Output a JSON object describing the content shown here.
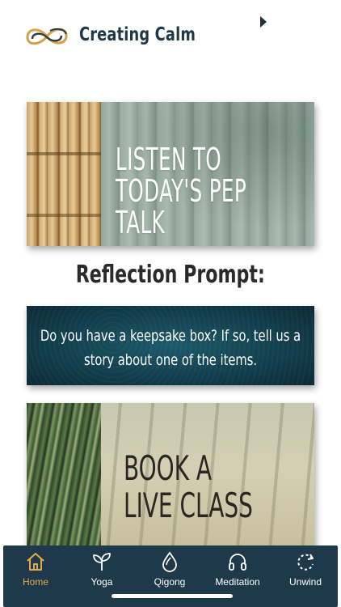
{
  "app": {
    "title": "Creating Calm",
    "logo_icon": "infinity-logo-icon"
  },
  "header": {
    "play_icon": "play-triangle-icon"
  },
  "pep_card": {
    "text_line1": "LISTEN TO",
    "text_line2": "TODAY'S PEP TALK"
  },
  "reflection": {
    "heading": "Reflection Prompt:",
    "prompt_line1": "Do you have a keepsake box? If so, tell us a",
    "prompt_line2": "story about one of the items."
  },
  "book_card": {
    "text_line1": "BOOK A",
    "text_line2": "LIVE CLASS"
  },
  "tabs": [
    {
      "label": "Home",
      "icon": "home-icon",
      "active": true
    },
    {
      "label": "Yoga",
      "icon": "sprout-icon",
      "active": false
    },
    {
      "label": "Qigong",
      "icon": "drop-icon",
      "active": false
    },
    {
      "label": "Meditation",
      "icon": "headphones-icon",
      "active": false
    },
    {
      "label": "Unwind",
      "icon": "refresh-icon",
      "active": false
    }
  ],
  "colors": {
    "tabbar": "#1e3949",
    "active_tab": "#e3a94c",
    "title": "#1f3748"
  }
}
